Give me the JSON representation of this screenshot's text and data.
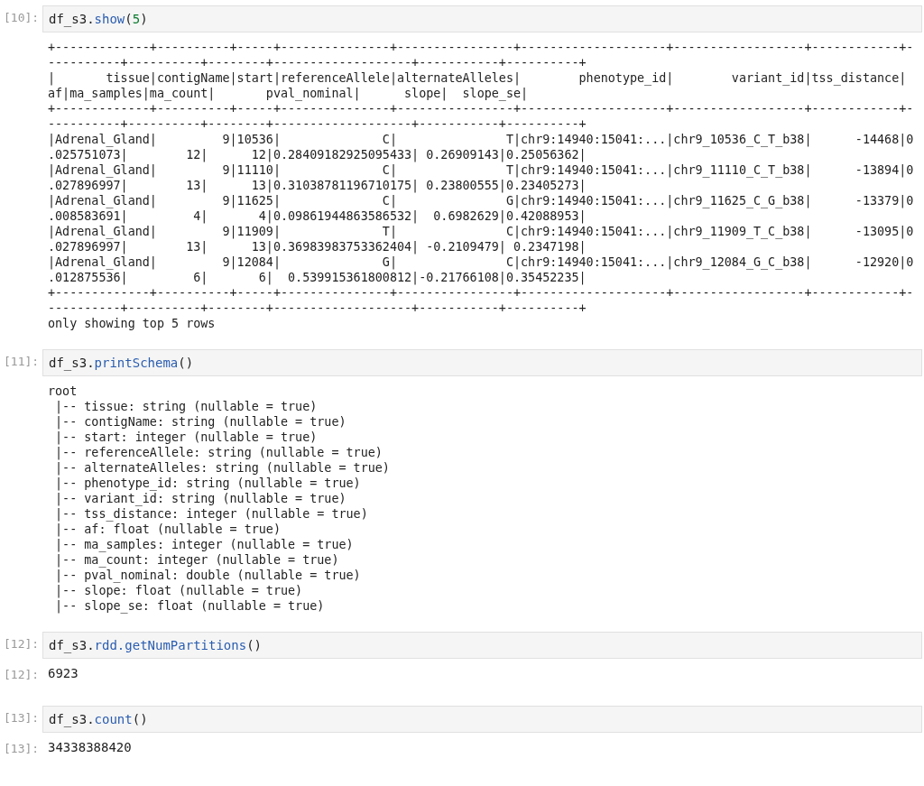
{
  "cells": [
    {
      "input_prompt": "[10]:",
      "code": [
        {
          "kind": "plain",
          "text": "df_s3."
        },
        {
          "kind": "call",
          "text": "show"
        },
        {
          "kind": "plain",
          "text": "("
        },
        {
          "kind": "number",
          "text": "5"
        },
        {
          "kind": "plain",
          "text": ")"
        }
      ],
      "output": {
        "lines": [
          "+-------------+----------+-----+---------------+----------------+--------------------+------------------+------------+-",
          "----------+----------+--------+-------------------+-----------+----------+",
          "|       tissue|contigName|start|referenceAllele|alternateAlleles|        phenotype_id|        variant_id|tss_distance|",
          "af|ma_samples|ma_count|       pval_nominal|      slope|  slope_se|",
          "+-------------+----------+-----+---------------+----------------+--------------------+------------------+------------+-",
          "----------+----------+--------+-------------------+-----------+----------+",
          "|Adrenal_Gland|         9|10536|              C|               T|chr9:14940:15041:...|chr9_10536_C_T_b38|      -14468|0",
          ".025751073|        12|      12|0.28409182925095433| 0.26909143|0.25056362|",
          "|Adrenal_Gland|         9|11110|              C|               T|chr9:14940:15041:...|chr9_11110_C_T_b38|      -13894|0",
          ".027896997|        13|      13|0.31038781196710175| 0.23800555|0.23405273|",
          "|Adrenal_Gland|         9|11625|              C|               G|chr9:14940:15041:...|chr9_11625_C_G_b38|      -13379|0",
          ".008583691|         4|       4|0.09861944863586532|  0.6982629|0.42088953|",
          "|Adrenal_Gland|         9|11909|              T|               C|chr9:14940:15041:...|chr9_11909_T_C_b38|      -13095|0",
          ".027896997|        13|      13|0.36983983753362404| -0.2109479| 0.2347198|",
          "|Adrenal_Gland|         9|12084|              G|               C|chr9:14940:15041:...|chr9_12084_G_C_b38|      -12920|0",
          ".012875536|         6|       6|  0.539915361800812|-0.21766108|0.35452235|",
          "+-------------+----------+-----+---------------+----------------+--------------------+------------------+------------+-",
          "----------+----------+--------+-------------------+-----------+----------+",
          "only showing top 5 rows"
        ]
      }
    },
    {
      "input_prompt": "[11]:",
      "code": [
        {
          "kind": "plain",
          "text": "df_s3."
        },
        {
          "kind": "call",
          "text": "printSchema"
        },
        {
          "kind": "plain",
          "text": "()"
        }
      ],
      "output": {
        "lines": [
          "root",
          " |-- tissue: string (nullable = true)",
          " |-- contigName: string (nullable = true)",
          " |-- start: integer (nullable = true)",
          " |-- referenceAllele: string (nullable = true)",
          " |-- alternateAlleles: string (nullable = true)",
          " |-- phenotype_id: string (nullable = true)",
          " |-- variant_id: string (nullable = true)",
          " |-- tss_distance: integer (nullable = true)",
          " |-- af: float (nullable = true)",
          " |-- ma_samples: integer (nullable = true)",
          " |-- ma_count: integer (nullable = true)",
          " |-- pval_nominal: double (nullable = true)",
          " |-- slope: float (nullable = true)",
          " |-- slope_se: float (nullable = true)"
        ]
      }
    },
    {
      "input_prompt": "[12]:",
      "code": [
        {
          "kind": "plain",
          "text": "df_s3."
        },
        {
          "kind": "call",
          "text": "rdd.getNumPartitions"
        },
        {
          "kind": "plain",
          "text": "()"
        }
      ],
      "output": {
        "prompt": "[12]:",
        "lines": [
          "6923"
        ]
      }
    },
    {
      "input_prompt": "[13]:",
      "code": [
        {
          "kind": "plain",
          "text": "df_s3."
        },
        {
          "kind": "call",
          "text": "count"
        },
        {
          "kind": "plain",
          "text": "()"
        }
      ],
      "output": {
        "prompt": "[13]:",
        "lines": [
          "34338388420"
        ]
      }
    }
  ]
}
